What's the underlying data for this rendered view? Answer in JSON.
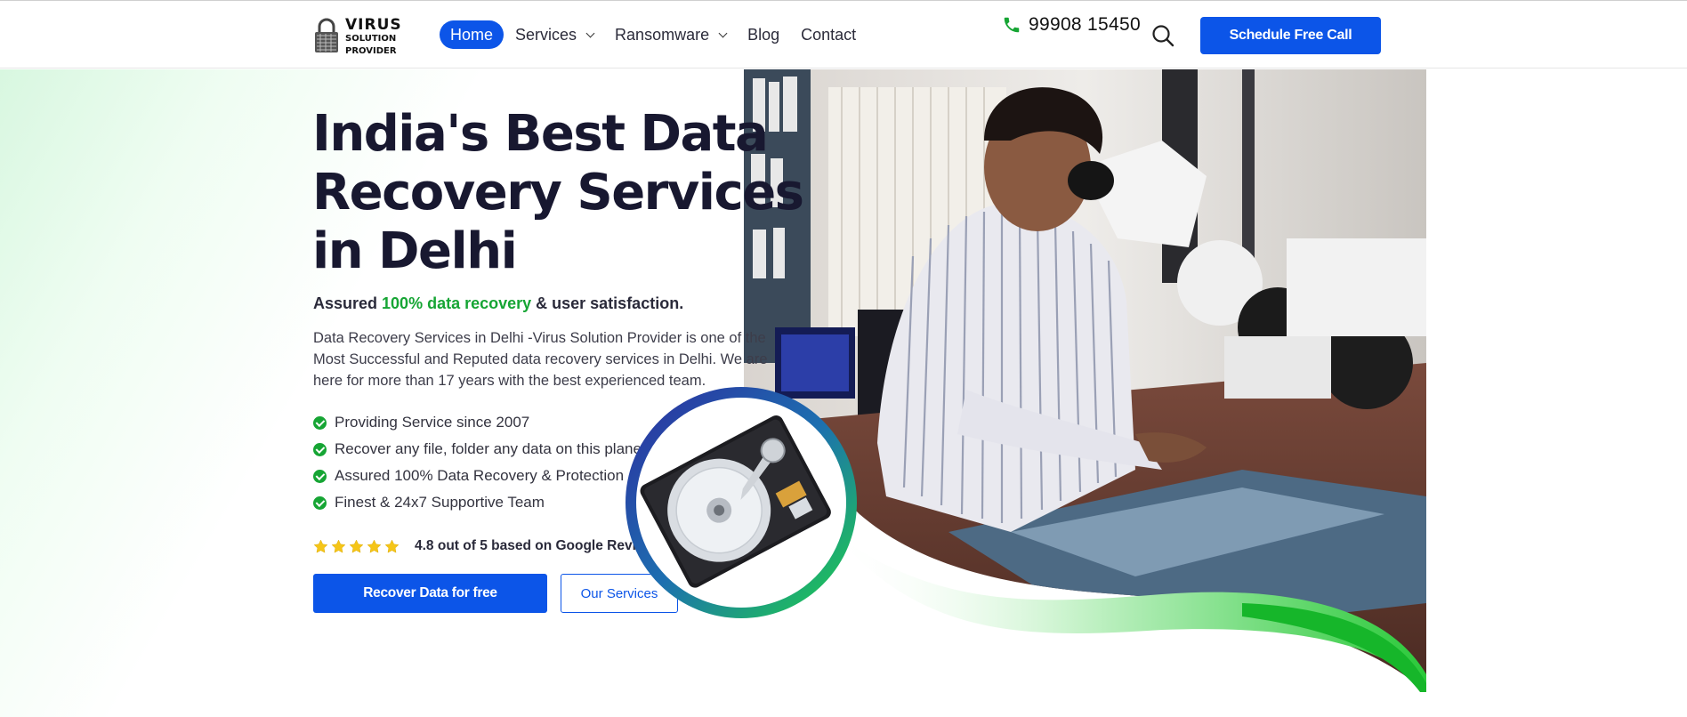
{
  "logo": {
    "line1": "VIRUS",
    "line2": "SOLUTION",
    "line3": "PROVIDER",
    "icon": "padlock-icon"
  },
  "nav": {
    "items": [
      {
        "label": "Home",
        "active": true,
        "dropdown": false
      },
      {
        "label": "Services",
        "active": false,
        "dropdown": true
      },
      {
        "label": "Ransomware",
        "active": false,
        "dropdown": true
      },
      {
        "label": "Blog",
        "active": false,
        "dropdown": false
      },
      {
        "label": "Contact",
        "active": false,
        "dropdown": false
      }
    ]
  },
  "header": {
    "phone": "99908 15450",
    "phone_icon": "phone-icon",
    "search_icon": "search-icon",
    "cta": "Schedule Free Call"
  },
  "hero": {
    "title": "India's Best Data Recovery Services in Delhi",
    "assured_prefix": "Assured ",
    "assured_highlight": "100% data recovery",
    "assured_suffix": " & user satisfaction.",
    "description": "Data Recovery Services in Delhi -Virus Solution Provider is one of the Most Successful and Reputed data recovery services in Delhi. We are here for more than 17 years with the best experienced team.",
    "features": [
      "Providing Service since 2007",
      "Recover any file, folder any data on this planet",
      "Assured 100% Data Recovery & Protection",
      "Finest & 24x7 Supportive Team"
    ],
    "rating": {
      "stars": 5,
      "text": "4.8 out of 5 based on Google Review"
    },
    "primary_button": "Recover Data for free",
    "secondary_button": "Our Services"
  },
  "colors": {
    "brand_blue": "#0c55e8",
    "brand_green": "#16a534",
    "star_yellow": "#f5c518",
    "heading": "#181830"
  }
}
